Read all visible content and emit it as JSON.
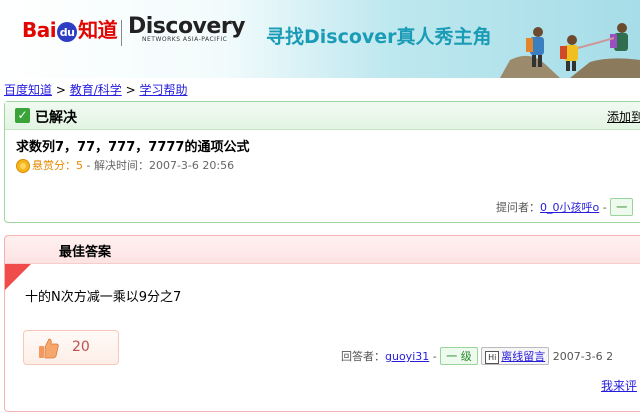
{
  "banner": {
    "baidu_text": "Bai",
    "baidu_paw": "du",
    "baidu_zhidao": "知道",
    "discovery_name": "Discovery",
    "discovery_sub": "NETWORKS ASIA-PACIFIC",
    "slogan": "寻找Discover真人秀主角"
  },
  "breadcrumb": {
    "items": [
      "百度知道",
      "教育/科学",
      "学习帮助"
    ],
    "separator": " > "
  },
  "question": {
    "status": "已解决",
    "add_link": "添加到",
    "title": "求数列7，77，777，7777的通项公式",
    "reward_label": "悬赏分：",
    "reward_value": "5",
    "resolved_label": " - 解决时间：2007-3-6 20:56",
    "asker_label": "提问者：",
    "asker_name": "0_0小孩呼o",
    "asker_sep": " - ",
    "asker_level": "一"
  },
  "answer": {
    "header": "最佳答案",
    "text": "十的N次方减一乘以9分之7",
    "like_count": "20",
    "answerer_label": "回答者：",
    "answerer_name": "guoyi31",
    "answerer_sep": " - ",
    "answerer_level": "一 级",
    "message_button": "离线留言",
    "time": "2007-3-6 2",
    "rate_link": "我来评"
  },
  "colors": {
    "link": "#261cdc",
    "green_border": "#9fd59f",
    "red_ribbon": "#f04c4c"
  }
}
